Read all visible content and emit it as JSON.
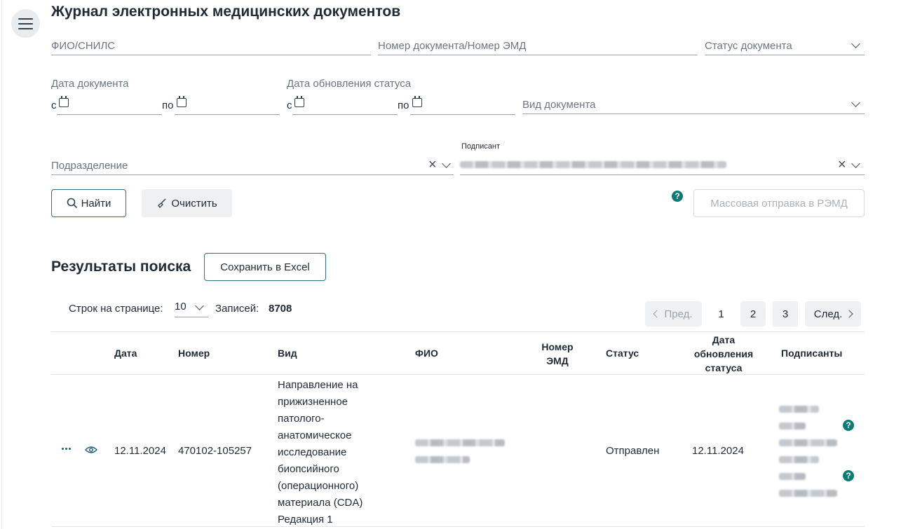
{
  "page_title": "Журнал электронных медицинских документов",
  "filters": {
    "fio_placeholder": "ФИО/СНИЛС",
    "doc_number_placeholder": "Номер документа/Номер ЭМД",
    "status_placeholder": "Статус документа",
    "doc_date_label": "Дата документа",
    "status_date_label": "Дата обновления статуса",
    "from_label": "с",
    "to_label": "по",
    "doc_type_placeholder": "Вид документа",
    "department_placeholder": "Подразделение",
    "signer_label": "Подписант"
  },
  "actions": {
    "search_label": "Найти",
    "clear_label": "Очистить",
    "mass_send_label": "Массовая отправка в РЭМД",
    "help_glyph": "?"
  },
  "results": {
    "title": "Результаты поиска",
    "export_label": "Сохранить в Excel",
    "rows_per_page_label": "Строк на странице:",
    "rows_per_page_value": "10",
    "records_label": "Записей:",
    "records_count": "8708"
  },
  "pagination": {
    "prev_label": "Пред.",
    "pages": [
      "1",
      "2",
      "3"
    ],
    "next_label": "След."
  },
  "table": {
    "headers": {
      "date": "Дата",
      "number": "Номер",
      "type": "Вид",
      "fio": "ФИО",
      "emd_number_line1": "Номер",
      "emd_number_line2": "ЭМД",
      "status": "Статус",
      "status_date_line1": "Дата",
      "status_date_line2": "обновления",
      "status_date_line3": "статуса",
      "signers": "Подписанты"
    },
    "rows": [
      {
        "date": "12.11.2024",
        "number": "470102-105257",
        "type_lines": [
          "Направление на",
          "прижизненное",
          "патолого-",
          "анатомическое",
          "исследование",
          "биопсийного",
          "(операционного)",
          "материала (CDA)",
          "Редакция 1"
        ],
        "emd_number": "",
        "status": "Отправлен",
        "status_date": "12.11.2024"
      }
    ]
  },
  "icons": {
    "menu": "menu-icon",
    "search": "search-icon",
    "broom": "broom-icon",
    "calendar": "calendar-icon",
    "chevron": "chevron-down-icon",
    "clear": "close-icon",
    "help": "help-icon",
    "more": "more-dots-icon",
    "eye": "eye-icon"
  },
  "colors": {
    "accent": "#2f6f7e",
    "help": "#0b7a75",
    "text": "#1f2a36"
  }
}
